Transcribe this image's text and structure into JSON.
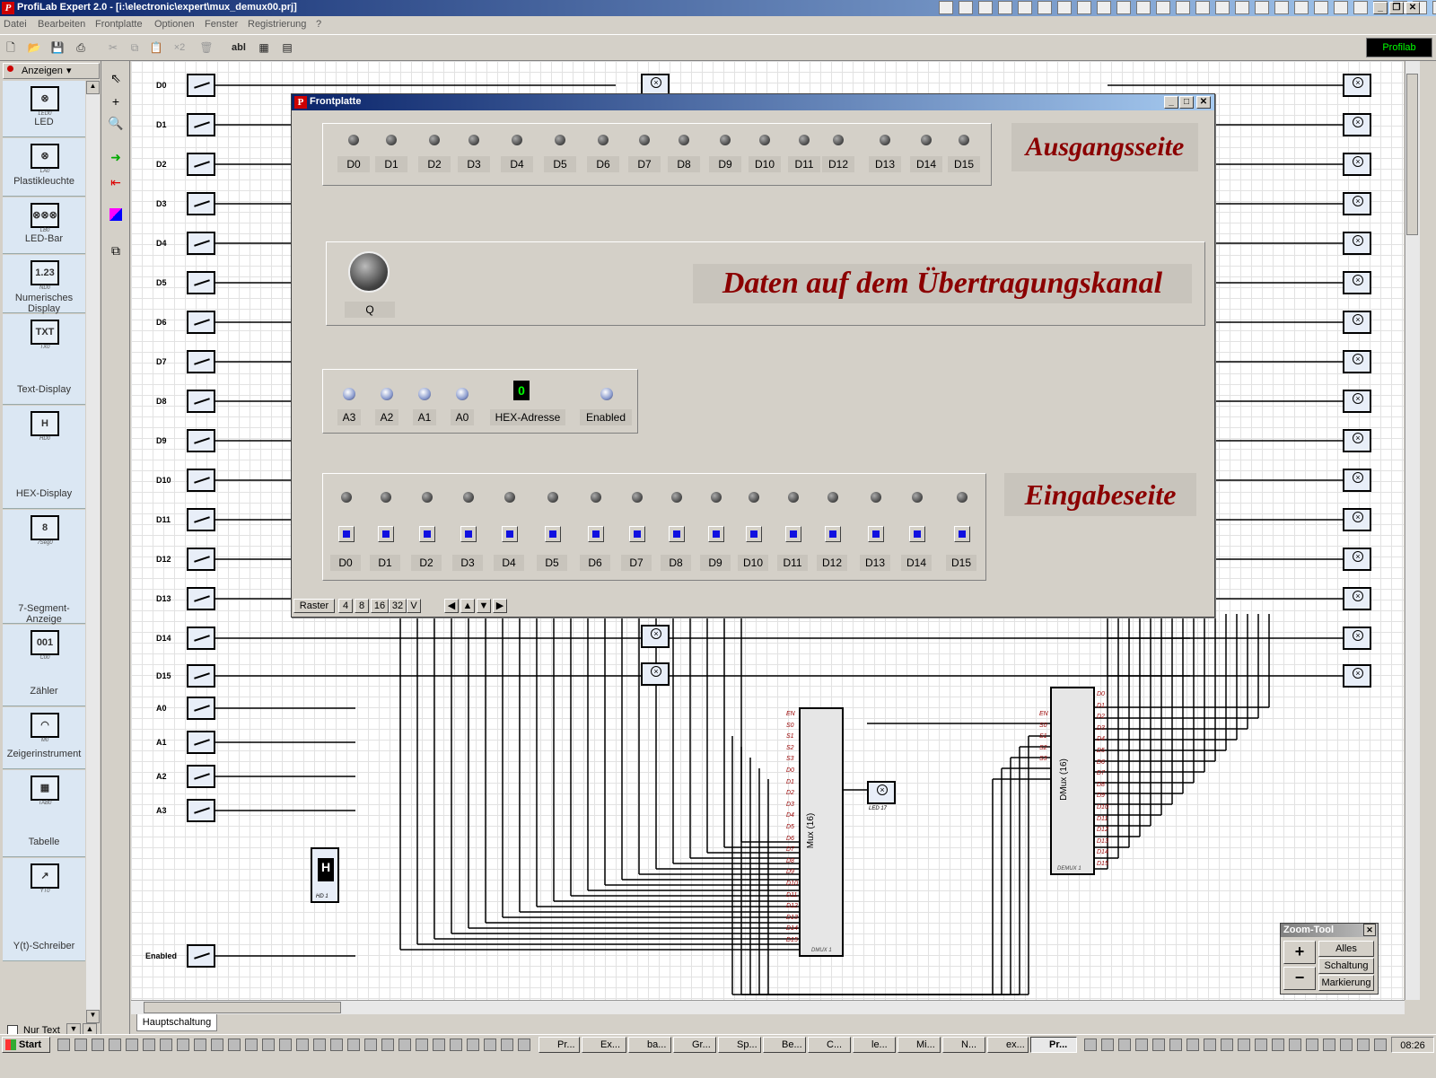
{
  "window": {
    "title": "ProfiLab Expert 2.0 - [i:\\electronic\\expert\\mux_demux00.prj]"
  },
  "menu": [
    "Datei",
    "Bearbeiten",
    "Frontplatte",
    "Optionen",
    "Fenster",
    "Registrierung",
    "?"
  ],
  "toolbar": {
    "badge": "Profilab",
    "text_tool": "abl",
    "times_two": "×2"
  },
  "palette": {
    "category": "Anzeigen",
    "items": [
      {
        "label": "LED",
        "icon": "⊗",
        "tag": "LED0"
      },
      {
        "label": "Plastikleuchte",
        "icon": "⊗",
        "tag": "LA0"
      },
      {
        "label": "LED-Bar",
        "icon": "⊗⊗⊗",
        "tag": "LB0"
      },
      {
        "label": "Numerisches Display",
        "icon": "1.23",
        "tag": "ND0"
      },
      {
        "label": "Text-Display",
        "icon": "TXT",
        "tag": "TX0"
      },
      {
        "label": "HEX-Display",
        "icon": "H",
        "tag": "HD0"
      },
      {
        "label": "7-Segment-Anzeige",
        "icon": "8",
        "tag": "7Seg0"
      },
      {
        "label": "Zähler",
        "icon": "001",
        "tag": "C00"
      },
      {
        "label": "Zeigerinstrument",
        "icon": "◠",
        "tag": "M0"
      },
      {
        "label": "Tabelle",
        "icon": "▦",
        "tag": "TAB0"
      },
      {
        "label": "Y(t)-Schreiber",
        "icon": "↗",
        "tag": "YT0"
      }
    ],
    "nur_text": "Nur Text"
  },
  "canvas": {
    "inputs": [
      "D0",
      "D1",
      "D2",
      "D3",
      "D4",
      "D5",
      "D6",
      "D7",
      "D8",
      "D9",
      "D10",
      "D11",
      "D12",
      "D13",
      "D14",
      "D15",
      "A0",
      "A1",
      "A2",
      "A3",
      "Enabled"
    ],
    "mux_title": "Mux (16)",
    "mux_tag": "DMUX 1",
    "dmux_title": "DMux (16)",
    "dmux_tag": "DEMUX 1",
    "mux_pins": [
      "EN",
      "S0",
      "S1",
      "S2",
      "S3",
      "D0",
      "D1",
      "D2",
      "D3",
      "D4",
      "D5",
      "D6",
      "D7",
      "D8",
      "D9",
      "D10",
      "D11",
      "D12",
      "D13",
      "D14",
      "D15"
    ],
    "dmux_in_pins": [
      "EN",
      "S0",
      "S1",
      "S2",
      "S3"
    ],
    "dmux_out_pins": [
      "D0",
      "D1",
      "D2",
      "D3",
      "D4",
      "D5",
      "D6",
      "D7",
      "D8",
      "D9",
      "D10",
      "D11",
      "D12",
      "D13",
      "D14",
      "D15"
    ],
    "hex_tag": "HD 1",
    "led17_tag": "LED 17",
    "tab": "Hauptschaltung"
  },
  "frontplatte": {
    "title": "Frontplatte",
    "output_labels": [
      "D0",
      "D1",
      "D2",
      "D3",
      "D4",
      "D5",
      "D6",
      "D7",
      "D8",
      "D9",
      "D10",
      "D11",
      "D12",
      "D13",
      "D14",
      "D15"
    ],
    "heading_out": "Ausgangsseite",
    "heading_channel": "Daten auf dem Übertragungskanal",
    "q_label": "Q",
    "addr_labels": [
      "A3",
      "A2",
      "A1",
      "A0"
    ],
    "hex_value": "0",
    "hex_label": "HEX-Adresse",
    "enabled_label": "Enabled",
    "heading_in": "Eingabeseite",
    "input_labels": [
      "D0",
      "D1",
      "D2",
      "D3",
      "D4",
      "D5",
      "D6",
      "D7",
      "D8",
      "D9",
      "D10",
      "D11",
      "D12",
      "D13",
      "D14",
      "D15"
    ],
    "raster_label": "Raster",
    "raster_options": [
      "4",
      "8",
      "16",
      "32",
      "V"
    ]
  },
  "zoom_tool": {
    "title": "Zoom-Tool",
    "plus": "+",
    "minus": "−",
    "buttons": [
      "Alles",
      "Schaltung",
      "Markierung"
    ]
  },
  "taskbar": {
    "start": "Start",
    "tasks": [
      "Pr...",
      "Ex...",
      "ba...",
      "Gr...",
      "Sp...",
      "Be...",
      "C...",
      "le...",
      "Mi...",
      "N...",
      "ex...",
      "Pr..."
    ],
    "clock": "08:26"
  },
  "colors": {
    "heading_text": "#8b0000",
    "title_bar": "#0a246a",
    "input_button": "#1010e0"
  }
}
